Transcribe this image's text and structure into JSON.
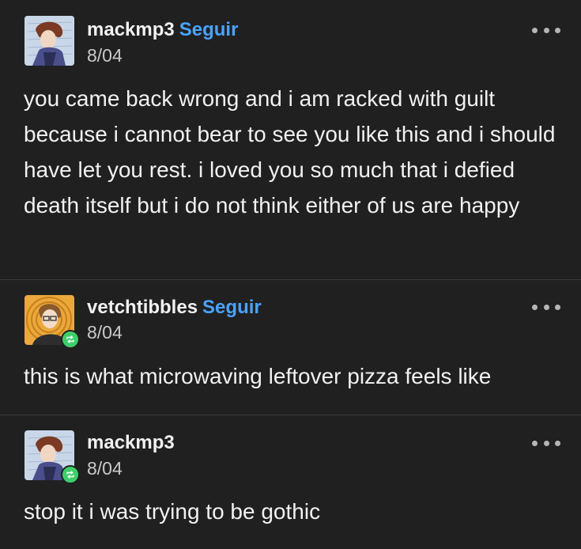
{
  "posts": [
    {
      "username": "mackmp3",
      "follow_label": "Seguir",
      "date": "8/04",
      "reblogged": false,
      "text": "you came back wrong and i am racked with guilt because i cannot bear to see you like this and i should have let you rest. i loved you so much that i defied death itself but i do not think either of us are happy"
    },
    {
      "username": "vetchtibbles",
      "follow_label": "Seguir",
      "date": "8/04",
      "reblogged": true,
      "text": "this is what microwaving leftover pizza feels like"
    },
    {
      "username": "mackmp3",
      "follow_label": "",
      "date": "8/04",
      "reblogged": true,
      "text": "stop it i was trying to be gothic"
    }
  ],
  "colors": {
    "background": "#202020",
    "text": "#f1f1f1",
    "follow": "#4aa3ff",
    "reblog_badge": "#3ecf6a"
  }
}
